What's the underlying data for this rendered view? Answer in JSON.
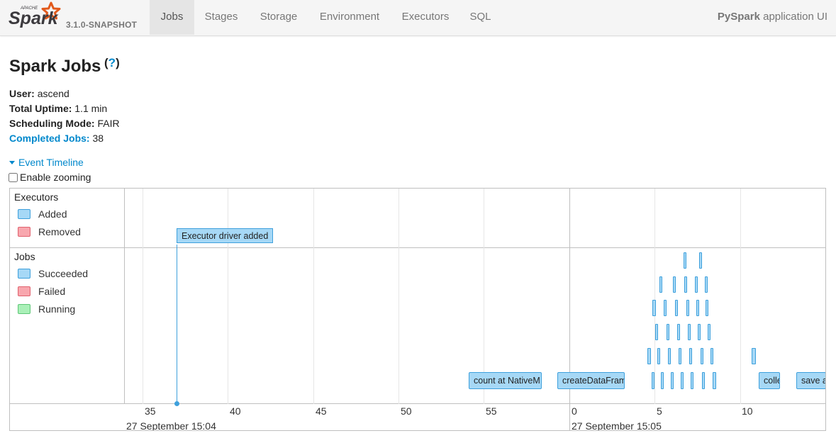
{
  "navbar": {
    "brand": "Spark",
    "brand_small": "APACHE",
    "version": "3.1.0-SNAPSHOT",
    "tabs": [
      {
        "label": "Jobs",
        "active": true
      },
      {
        "label": "Stages",
        "active": false
      },
      {
        "label": "Storage",
        "active": false
      },
      {
        "label": "Environment",
        "active": false
      },
      {
        "label": "Executors",
        "active": false
      },
      {
        "label": "SQL",
        "active": false
      }
    ],
    "app_name": "PySpark",
    "app_suffix": "application UI"
  },
  "page": {
    "title": "Spark Jobs",
    "help": "?"
  },
  "summary": {
    "user_label": "User:",
    "user_value": "ascend",
    "uptime_label": "Total Uptime:",
    "uptime_value": "1.1 min",
    "scheduling_label": "Scheduling Mode:",
    "scheduling_value": "FAIR",
    "completed_label": "Completed Jobs:",
    "completed_value": "38"
  },
  "timeline": {
    "toggle_label": "Event Timeline",
    "zoom_label": "Enable zooming",
    "executors_group": "Executors",
    "executor_legend": [
      {
        "label": "Added",
        "color": "#a6d8f6",
        "border": "#3ea0dc"
      },
      {
        "label": "Removed",
        "color": "#f8a7ae",
        "border": "#e0626e"
      }
    ],
    "jobs_group": "Jobs",
    "job_legend": [
      {
        "label": "Succeeded",
        "color": "#a6d8f6",
        "border": "#3ea0dc"
      },
      {
        "label": "Failed",
        "color": "#f8a7ae",
        "border": "#e0626e"
      },
      {
        "label": "Running",
        "color": "#aaf0b8",
        "border": "#5ec777"
      }
    ],
    "executor_event": "Executor driver added",
    "ticks": [
      "35",
      "40",
      "45",
      "50",
      "55",
      "0",
      "5",
      "10"
    ],
    "major_labels": [
      "27 September 15:04",
      "27 September 15:05"
    ],
    "job_labels": [
      "count at NativeM",
      "createDataFram",
      "colle",
      "save a"
    ]
  }
}
